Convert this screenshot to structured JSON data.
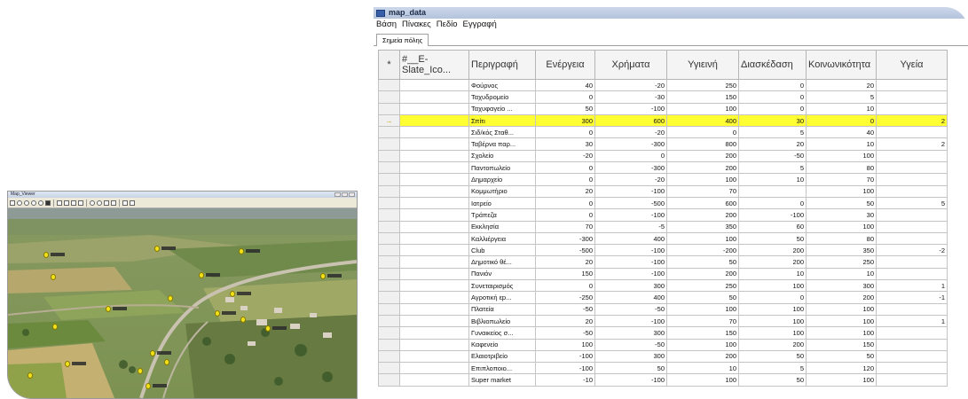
{
  "map_window": {
    "title": "Map_Viewer"
  },
  "data_window": {
    "title": "map_data",
    "menu": [
      "Βάση",
      "Πίνακες",
      "Πεδίο",
      "Εγγραφή"
    ],
    "tab": "Σημεία πόλης",
    "headers": {
      "selector": "*",
      "icon": "#__E-Slate_Ico...",
      "desc": "Περιγραφή",
      "energy": "Ενέργεια",
      "money": "Χρήματα",
      "health": "Υγιεινή",
      "fun": "Διασκέδαση",
      "social": "Κοινωνικότητα",
      "health2": "Υγεία"
    },
    "selected_marker": "→",
    "highlight_color": "#ffff33",
    "rows": [
      {
        "d": "Φούρνος",
        "e": "40",
        "m": "-20",
        "h": "250",
        "f": "0",
        "s": "20",
        "g": ""
      },
      {
        "d": "Ταχυδρομείο",
        "e": "0",
        "m": "-30",
        "h": "150",
        "f": "0",
        "s": "5",
        "g": ""
      },
      {
        "d": "Ταχυφαγείο ...",
        "e": "50",
        "m": "-100",
        "h": "100",
        "f": "0",
        "s": "10",
        "g": ""
      },
      {
        "d": "Σπίτι",
        "e": "300",
        "m": "600",
        "h": "400",
        "f": "30",
        "s": "0",
        "g": "2"
      },
      {
        "d": "Σιδ/κός Σταθ...",
        "e": "0",
        "m": "-20",
        "h": "0",
        "f": "5",
        "s": "40",
        "g": ""
      },
      {
        "d": "Ταβέρνα παρ...",
        "e": "30",
        "m": "-300",
        "h": "800",
        "f": "20",
        "s": "10",
        "g": "2"
      },
      {
        "d": "Σχολείο",
        "e": "-20",
        "m": "0",
        "h": "200",
        "f": "-50",
        "s": "100",
        "g": ""
      },
      {
        "d": "Παντοπωλείο",
        "e": "0",
        "m": "-300",
        "h": "200",
        "f": "5",
        "s": "80",
        "g": ""
      },
      {
        "d": "Δημαρχείο",
        "e": "0",
        "m": "-20",
        "h": "100",
        "f": "10",
        "s": "70",
        "g": ""
      },
      {
        "d": "Κομμωτήριο",
        "e": "20",
        "m": "-100",
        "h": "70",
        "f": "",
        "s": "100",
        "g": ""
      },
      {
        "d": "Ιατρείο",
        "e": "0",
        "m": "-500",
        "h": "600",
        "f": "0",
        "s": "50",
        "g": "5"
      },
      {
        "d": "Τράπεζα",
        "e": "0",
        "m": "-100",
        "h": "200",
        "f": "-100",
        "s": "30",
        "g": ""
      },
      {
        "d": "Εκκλησία",
        "e": "70",
        "m": "-5",
        "h": "350",
        "f": "60",
        "s": "100",
        "g": ""
      },
      {
        "d": "Καλλιέργεια",
        "e": "-300",
        "m": "400",
        "h": "100",
        "f": "50",
        "s": "80",
        "g": ""
      },
      {
        "d": "Club",
        "e": "-500",
        "m": "-100",
        "h": "-200",
        "f": "200",
        "s": "350",
        "g": "-2"
      },
      {
        "d": "Δημοτικό θέ...",
        "e": "20",
        "m": "-100",
        "h": "50",
        "f": "200",
        "s": "250",
        "g": ""
      },
      {
        "d": "Πανιόν",
        "e": "150",
        "m": "-100",
        "h": "200",
        "f": "10",
        "s": "10",
        "g": ""
      },
      {
        "d": "Συνεταιρισμός",
        "e": "0",
        "m": "300",
        "h": "250",
        "f": "100",
        "s": "300",
        "g": "1"
      },
      {
        "d": "Αγροτική εp...",
        "e": "-250",
        "m": "400",
        "h": "50",
        "f": "0",
        "s": "200",
        "g": "-1"
      },
      {
        "d": "Πλατεία",
        "e": "-50",
        "m": "-50",
        "h": "100",
        "f": "100",
        "s": "100",
        "g": ""
      },
      {
        "d": "Βιβλιοπωλείο",
        "e": "20",
        "m": "-100",
        "h": "70",
        "f": "100",
        "s": "100",
        "g": "1"
      },
      {
        "d": "Γυναικείος σ...",
        "e": "-50",
        "m": "300",
        "h": "150",
        "f": "100",
        "s": "100",
        "g": ""
      },
      {
        "d": "Καφενείο",
        "e": "100",
        "m": "-50",
        "h": "100",
        "f": "200",
        "s": "150",
        "g": ""
      },
      {
        "d": "Ελαιοτριβείο",
        "e": "-100",
        "m": "300",
        "h": "200",
        "f": "50",
        "s": "50",
        "g": ""
      },
      {
        "d": "Επιπλοποιο...",
        "e": "-100",
        "m": "50",
        "h": "10",
        "f": "5",
        "s": "120",
        "g": ""
      },
      {
        "d": "Super market",
        "e": "-10",
        "m": "-100",
        "h": "100",
        "f": "50",
        "s": "100",
        "g": ""
      }
    ],
    "highlight_index": 3
  }
}
